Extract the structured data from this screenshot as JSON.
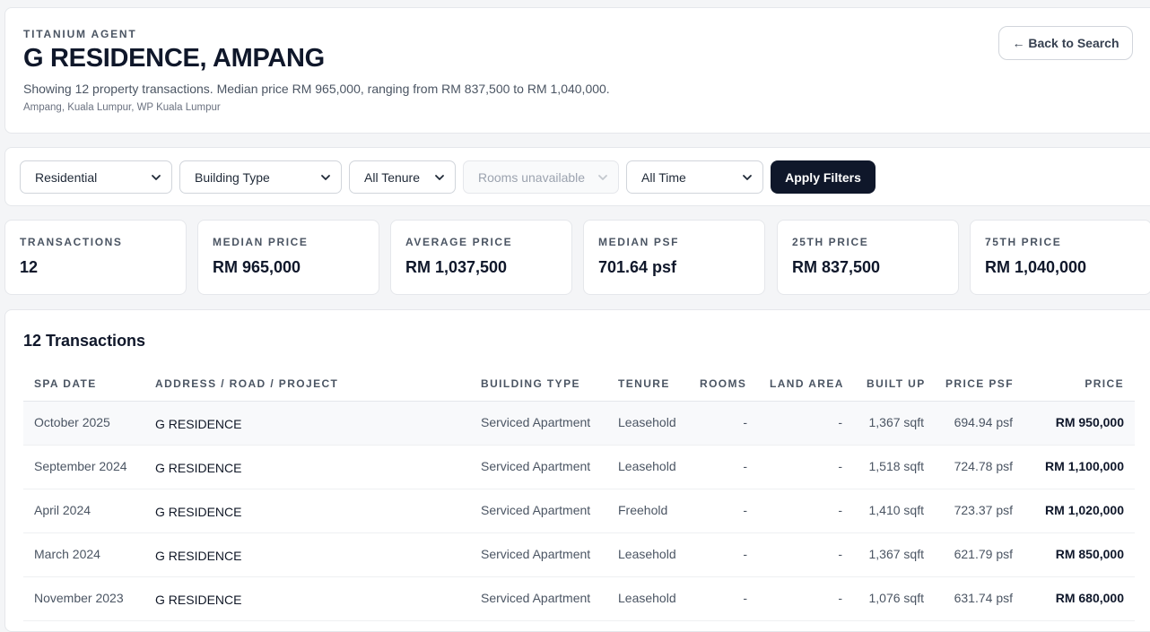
{
  "header": {
    "brand": "TITANIUM AGENT",
    "title": "G RESIDENCE, AMPANG",
    "summary": "Showing 12 property transactions. Median price RM 965,000, ranging from RM 837,500 to RM 1,040,000.",
    "location": "Ampang, Kuala Lumpur, WP Kuala Lumpur",
    "back_label": "← Back to Search"
  },
  "filters": {
    "property_class": "Residential",
    "building_type": "Building Type",
    "tenure": "All Tenure",
    "rooms": "Rooms unavailable",
    "time": "All Time",
    "apply_label": "Apply Filters"
  },
  "stats": [
    {
      "label": "TRANSACTIONS",
      "value": "12"
    },
    {
      "label": "MEDIAN PRICE",
      "value": "RM 965,000"
    },
    {
      "label": "AVERAGE PRICE",
      "value": "RM 1,037,500"
    },
    {
      "label": "MEDIAN PSF",
      "value": "701.64 psf"
    },
    {
      "label": "25TH PRICE",
      "value": "RM 837,500"
    },
    {
      "label": "75TH PRICE",
      "value": "RM 1,040,000"
    }
  ],
  "table": {
    "title": "12 Transactions",
    "columns": [
      "SPA DATE",
      "ADDRESS / ROAD / PROJECT",
      "BUILDING TYPE",
      "TENURE",
      "ROOMS",
      "LAND AREA",
      "BUILT UP",
      "PRICE PSF",
      "PRICE"
    ],
    "rows": [
      {
        "date": "October 2025",
        "address": "G RESIDENCE",
        "type": "Serviced Apartment",
        "tenure": "Leasehold",
        "rooms": "-",
        "land": "-",
        "built_up": "1,367 sqft",
        "psf": "694.94 psf",
        "price": "RM 950,000"
      },
      {
        "date": "September 2024",
        "address": "G RESIDENCE",
        "type": "Serviced Apartment",
        "tenure": "Leasehold",
        "rooms": "-",
        "land": "-",
        "built_up": "1,518 sqft",
        "psf": "724.78 psf",
        "price": "RM 1,100,000"
      },
      {
        "date": "April 2024",
        "address": "G RESIDENCE",
        "type": "Serviced Apartment",
        "tenure": "Freehold",
        "rooms": "-",
        "land": "-",
        "built_up": "1,410 sqft",
        "psf": "723.37 psf",
        "price": "RM 1,020,000"
      },
      {
        "date": "March 2024",
        "address": "G RESIDENCE",
        "type": "Serviced Apartment",
        "tenure": "Leasehold",
        "rooms": "-",
        "land": "-",
        "built_up": "1,367 sqft",
        "psf": "621.79 psf",
        "price": "RM 850,000"
      },
      {
        "date": "November 2023",
        "address": "G RESIDENCE",
        "type": "Serviced Apartment",
        "tenure": "Leasehold",
        "rooms": "-",
        "land": "-",
        "built_up": "1,076 sqft",
        "psf": "631.74 psf",
        "price": "RM 680,000"
      }
    ]
  }
}
